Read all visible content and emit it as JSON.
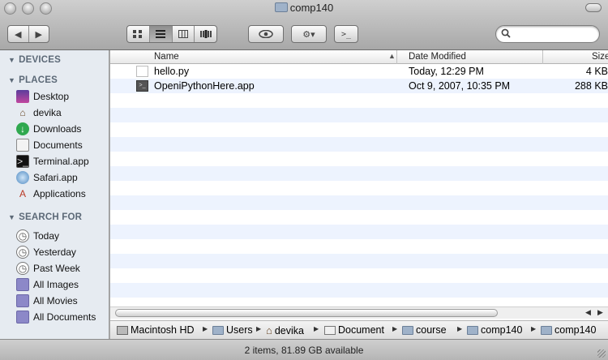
{
  "window": {
    "title": "comp140"
  },
  "toolbar": {
    "back_glyph": "◀",
    "forward_glyph": "▶",
    "view_icons": [
      "icon-view-icon",
      "list-view-icon",
      "column-view-icon",
      "coverflow-view-icon"
    ],
    "eye_glyph": "👁",
    "gear_glyph": "⚙▾",
    "terminal_glyph": ">_",
    "search_placeholder": ""
  },
  "sidebar": {
    "devices_header": "DEVICES",
    "places_header": "PLACES",
    "search_header": "SEARCH FOR",
    "places": [
      {
        "label": "Desktop",
        "icon": "desktop-icon"
      },
      {
        "label": "devika",
        "icon": "home-icon"
      },
      {
        "label": "Downloads",
        "icon": "downloads-icon"
      },
      {
        "label": "Documents",
        "icon": "documents-icon"
      },
      {
        "label": "Terminal.app",
        "icon": "terminal-icon"
      },
      {
        "label": "Safari.app",
        "icon": "safari-icon"
      },
      {
        "label": "Applications",
        "icon": "applications-icon"
      }
    ],
    "searches": [
      {
        "label": "Today",
        "icon": "clock-icon"
      },
      {
        "label": "Yesterday",
        "icon": "clock-icon"
      },
      {
        "label": "Past Week",
        "icon": "clock-icon"
      },
      {
        "label": "All Images",
        "icon": "smart-folder-icon"
      },
      {
        "label": "All Movies",
        "icon": "smart-folder-icon"
      },
      {
        "label": "All Documents",
        "icon": "smart-folder-icon"
      }
    ]
  },
  "columns": {
    "name": "Name",
    "date": "Date Modified",
    "size": "Size"
  },
  "files": [
    {
      "name": "hello.py",
      "date": "Today, 12:29 PM",
      "size": "4 KB"
    },
    {
      "name": "OpeniPythonHere.app",
      "date": "Oct 9, 2007, 10:35 PM",
      "size": "288 KB"
    }
  ],
  "pathbar": [
    "Macintosh HD",
    "Users",
    "devika",
    "Document",
    "course",
    "comp140",
    "comp140"
  ],
  "status": "2 items, 81.89 GB available"
}
